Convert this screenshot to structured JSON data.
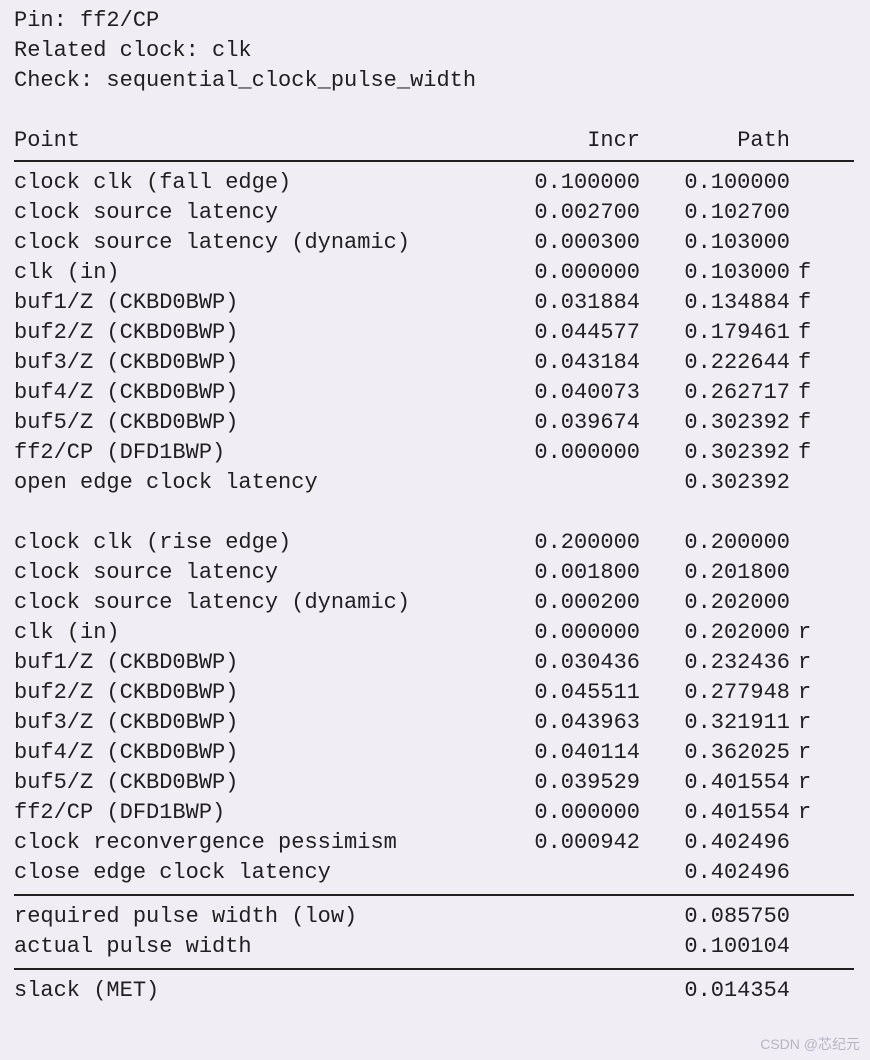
{
  "header": {
    "pin_label": "Pin: ff2/CP",
    "clock_label": "Related clock: clk",
    "check_label": "Check: sequential_clock_pulse_width"
  },
  "columns": {
    "point": "Point",
    "incr": "Incr",
    "path": "Path"
  },
  "section1": [
    {
      "point": "clock clk (fall edge)",
      "incr": "0.100000",
      "path": "0.100000",
      "edge": ""
    },
    {
      "point": "clock source latency",
      "incr": "0.002700",
      "path": "0.102700",
      "edge": ""
    },
    {
      "point": "clock source latency (dynamic)",
      "incr": "0.000300",
      "path": "0.103000",
      "edge": ""
    },
    {
      "point": "clk (in)",
      "incr": "0.000000",
      "path": "0.103000",
      "edge": "f"
    },
    {
      "point": "buf1/Z (CKBD0BWP)",
      "incr": "0.031884",
      "path": "0.134884",
      "edge": "f"
    },
    {
      "point": "buf2/Z (CKBD0BWP)",
      "incr": "0.044577",
      "path": "0.179461",
      "edge": "f"
    },
    {
      "point": "buf3/Z (CKBD0BWP)",
      "incr": "0.043184",
      "path": "0.222644",
      "edge": "f"
    },
    {
      "point": "buf4/Z (CKBD0BWP)",
      "incr": "0.040073",
      "path": "0.262717",
      "edge": "f"
    },
    {
      "point": "buf5/Z (CKBD0BWP)",
      "incr": "0.039674",
      "path": "0.302392",
      "edge": "f"
    },
    {
      "point": "ff2/CP (DFD1BWP)",
      "incr": "0.000000",
      "path": "0.302392",
      "edge": "f"
    },
    {
      "point": "open edge clock latency",
      "incr": "",
      "path": "0.302392",
      "edge": ""
    }
  ],
  "section2": [
    {
      "point": "clock clk (rise edge)",
      "incr": "0.200000",
      "path": "0.200000",
      "edge": ""
    },
    {
      "point": "clock source latency",
      "incr": "0.001800",
      "path": "0.201800",
      "edge": ""
    },
    {
      "point": "clock source latency (dynamic)",
      "incr": "0.000200",
      "path": "0.202000",
      "edge": ""
    },
    {
      "point": "clk (in)",
      "incr": "0.000000",
      "path": "0.202000",
      "edge": "r"
    },
    {
      "point": "buf1/Z (CKBD0BWP)",
      "incr": "0.030436",
      "path": "0.232436",
      "edge": "r"
    },
    {
      "point": "buf2/Z (CKBD0BWP)",
      "incr": "0.045511",
      "path": "0.277948",
      "edge": "r"
    },
    {
      "point": "buf3/Z (CKBD0BWP)",
      "incr": "0.043963",
      "path": "0.321911",
      "edge": "r"
    },
    {
      "point": "buf4/Z (CKBD0BWP)",
      "incr": "0.040114",
      "path": "0.362025",
      "edge": "r"
    },
    {
      "point": "buf5/Z (CKBD0BWP)",
      "incr": "0.039529",
      "path": "0.401554",
      "edge": "r"
    },
    {
      "point": "ff2/CP (DFD1BWP)",
      "incr": "0.000000",
      "path": "0.401554",
      "edge": "r"
    },
    {
      "point": "clock reconvergence pessimism",
      "incr": "0.000942",
      "path": "0.402496",
      "edge": ""
    },
    {
      "point": "close edge clock latency",
      "incr": "",
      "path": "0.402496",
      "edge": ""
    }
  ],
  "summary": [
    {
      "point": "required pulse width (low)",
      "incr": "",
      "path": "0.085750",
      "edge": ""
    },
    {
      "point": "actual pulse width",
      "incr": "",
      "path": "0.100104",
      "edge": ""
    }
  ],
  "slack": {
    "point": "slack (MET)",
    "incr": "",
    "path": "0.014354",
    "edge": ""
  },
  "watermark": "CSDN @芯纪元"
}
